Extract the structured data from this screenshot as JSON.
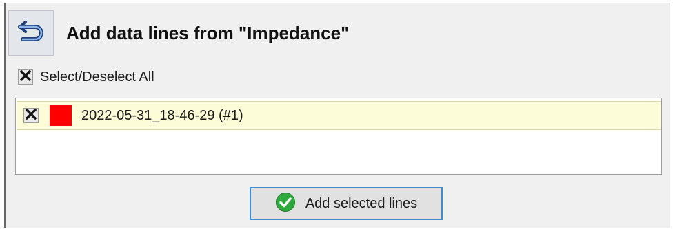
{
  "dialog": {
    "title": "Add data lines from \"Impedance\"",
    "back_icon": "back-arrow-icon",
    "accent_color": "#3c8cd8"
  },
  "select_all": {
    "label": "Select/Deselect All",
    "checked": true,
    "check_icon": "x-mark-icon"
  },
  "lines": [
    {
      "label": "2022-05-31_18-46-29 (#1)",
      "checked": true,
      "color": "#ff0000"
    }
  ],
  "add_button": {
    "label": "Add selected lines",
    "icon": "check-circle-icon",
    "icon_color": "#2eaa3c"
  }
}
